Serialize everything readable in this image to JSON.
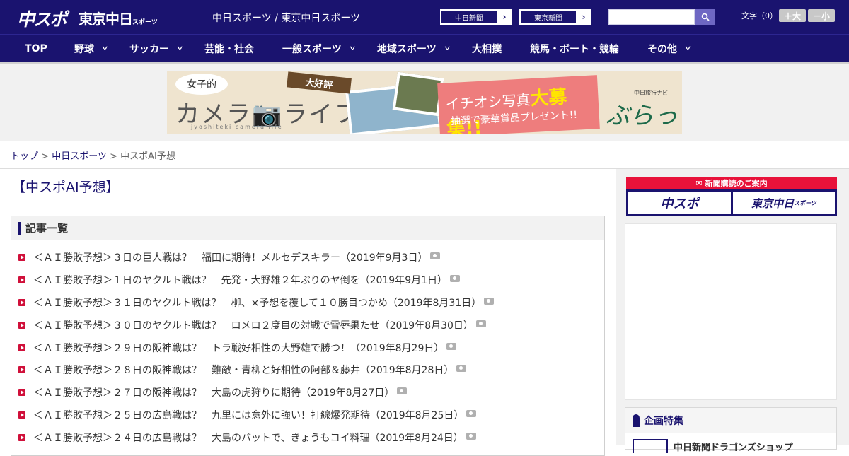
{
  "header": {
    "logo_chuspo": "中スポ",
    "logo_tokyo": "東京中日",
    "logo_tokyo_sub": "スポーツ",
    "sites_text": "中日スポーツ / 東京中日スポーツ",
    "chunichi_button": "中日新聞",
    "tokyo_button": "東京新聞",
    "search_placeholder": "",
    "font_size_label": "文字（0）",
    "font_plus": "＋大",
    "font_minus": "－小"
  },
  "nav": {
    "items": [
      {
        "label": "TOP",
        "dropdown": false
      },
      {
        "label": "野球",
        "dropdown": true
      },
      {
        "label": "サッカー",
        "dropdown": true
      },
      {
        "label": "芸能・社会",
        "dropdown": false
      },
      {
        "label": "一般スポーツ",
        "dropdown": true
      },
      {
        "label": "地域スポーツ",
        "dropdown": true
      },
      {
        "label": "大相撲",
        "dropdown": false
      },
      {
        "label": "競馬・ボート・競輪",
        "dropdown": false
      },
      {
        "label": "その他",
        "dropdown": true
      }
    ]
  },
  "banner": {
    "bubble": "女子的",
    "title": "カメラ📷ライフ",
    "subtitle": "jyoshiteki camera life",
    "tag": "大好評",
    "headline": "イチオシ写真",
    "headline_emph": "大募集!!",
    "prize": "抽選で豪華賞品プレゼント!!",
    "brand_small": "中日旅行ナビ",
    "brand": "ぶらっ人"
  },
  "breadcrumb": {
    "home": "トップ",
    "section": "中日スポーツ",
    "current": "中スポAI予想",
    "sep": ">"
  },
  "page_title": "【中スポAI予想】",
  "article_list": {
    "heading": "記事一覧",
    "items": [
      "＜ＡＩ勝敗予想＞３日の巨人戦は？　福田に期待！メルセデスキラー（2019年9月3日）",
      "＜ＡＩ勝敗予想＞１日のヤクルト戦は？　先発・大野雄２年ぶりのヤ倒を（2019年9月1日）",
      "＜ＡＩ勝敗予想＞３１日のヤクルト戦は？　柳、×予想を覆して１０勝目つかめ（2019年8月31日）",
      "＜ＡＩ勝敗予想＞３０日のヤクルト戦は？　ロメロ２度目の対戦で雪辱果たせ（2019年8月30日）",
      "＜ＡＩ勝敗予想＞２９日の阪神戦は？　トラ戦好相性の大野雄で勝つ！（2019年8月29日）",
      "＜ＡＩ勝敗予想＞２８日の阪神戦は？　難敵・青柳と好相性の阿部＆藤井（2019年8月28日）",
      "＜ＡＩ勝敗予想＞２７日の阪神戦は？　大島の虎狩りに期待（2019年8月27日）",
      "＜ＡＩ勝敗予想＞２５日の広島戦は？　九里には意外に強い！打線爆発期待（2019年8月25日）",
      "＜ＡＩ勝敗予想＞２４日の広島戦は？　大島のバットで、きょうもコイ料理（2019年8月24日）"
    ]
  },
  "sidebar": {
    "subscribe_heading": "新聞購読のご案内",
    "subscribe_chuspo": "中スポ",
    "subscribe_tokyo": "東京中日",
    "subscribe_tokyo_sub": "スポーツ",
    "feature_heading": "企画特集",
    "feature_item": "中日新聞ドラゴンズショップ"
  },
  "colors": {
    "brand_navy": "#1a136f",
    "accent_red": "#d0103a",
    "subscribe_red": "#e8123a"
  }
}
